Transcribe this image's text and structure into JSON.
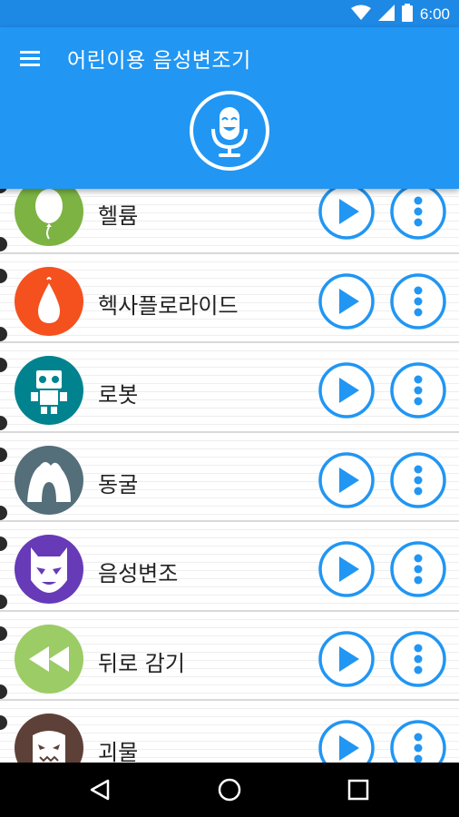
{
  "status_bar": {
    "time": "6:00",
    "icons": [
      "wifi-icon",
      "signal-icon",
      "battery-icon"
    ]
  },
  "app_bar": {
    "title": "어린이용 음성변조기",
    "menu_icon": "hamburger-menu-icon",
    "record_icon": "microphone-icon"
  },
  "effects": [
    {
      "label": "헬륨",
      "icon": "balloon-icon",
      "color": "#7cb342"
    },
    {
      "label": "헥사플로라이드",
      "icon": "egg-icon",
      "color": "#f4511e"
    },
    {
      "label": "로봇",
      "icon": "robot-icon",
      "color": "#00838f"
    },
    {
      "label": "동굴",
      "icon": "cave-icon",
      "color": "#546e7a"
    },
    {
      "label": "음성변조",
      "icon": "mask-icon",
      "color": "#673ab7"
    },
    {
      "label": "뒤로 감기",
      "icon": "rewind-icon",
      "color": "#9ccc65"
    },
    {
      "label": "괴물",
      "icon": "monster-icon",
      "color": "#5d4037"
    }
  ],
  "row_actions": {
    "play_icon": "play-icon",
    "more_icon": "more-vertical-icon"
  },
  "navigation": {
    "back_icon": "back-triangle-icon",
    "home_icon": "home-circle-icon",
    "recents_icon": "recents-square-icon"
  },
  "colors": {
    "status_bar": "#1e88e5",
    "app_bar": "#2196f3",
    "accent": "#2196f3",
    "nav_bar": "#000000"
  }
}
